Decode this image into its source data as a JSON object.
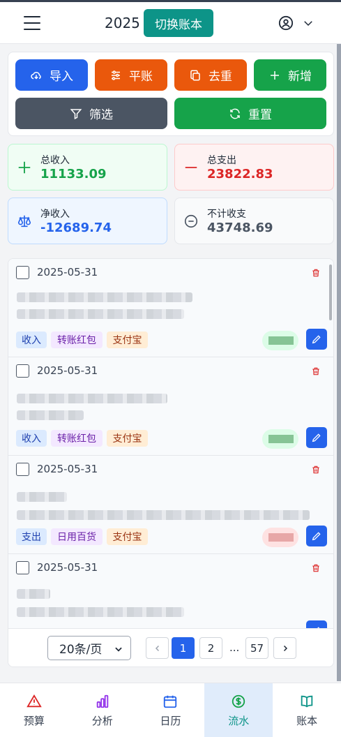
{
  "header": {
    "year": "2025",
    "switch_label": "切换账本",
    "menu_icon": "menu-icon",
    "user_icon": "user-circle-icon"
  },
  "actions": {
    "import_label": "导入",
    "balance_label": "平账",
    "dedupe_label": "去重",
    "add_label": "新增",
    "filter_label": "筛选",
    "reset_label": "重置"
  },
  "stats": {
    "income_label": "总收入",
    "income_value": "11133.09",
    "expense_label": "总支出",
    "expense_value": "23822.83",
    "net_label": "净收入",
    "net_value": "-12689.74",
    "excluded_label": "不计收支",
    "excluded_value": "43748.69"
  },
  "transactions": [
    {
      "date": "2025-05-31",
      "tags": [
        "收入",
        "转账红包",
        "支付宝"
      ]
    },
    {
      "date": "2025-05-31",
      "tags": [
        "收入",
        "转账红包",
        "支付宝"
      ]
    },
    {
      "date": "2025-05-31",
      "tags": [
        "支出",
        "日用百货",
        "支付宝"
      ]
    },
    {
      "date": "2025-05-31",
      "tags": []
    }
  ],
  "pagination": {
    "page_size": "20条/页",
    "pages": [
      "1",
      "2",
      "57"
    ],
    "ellipsis": "...",
    "current": "1"
  },
  "nav": {
    "budget": "预算",
    "analysis": "分析",
    "calendar": "日历",
    "flow": "流水",
    "ledger": "账本"
  },
  "colors": {
    "teal": "#0d9488",
    "blue": "#2563eb",
    "orange": "#ea580c",
    "green": "#16a34a",
    "gray": "#4b5563",
    "red": "#dc2626"
  }
}
